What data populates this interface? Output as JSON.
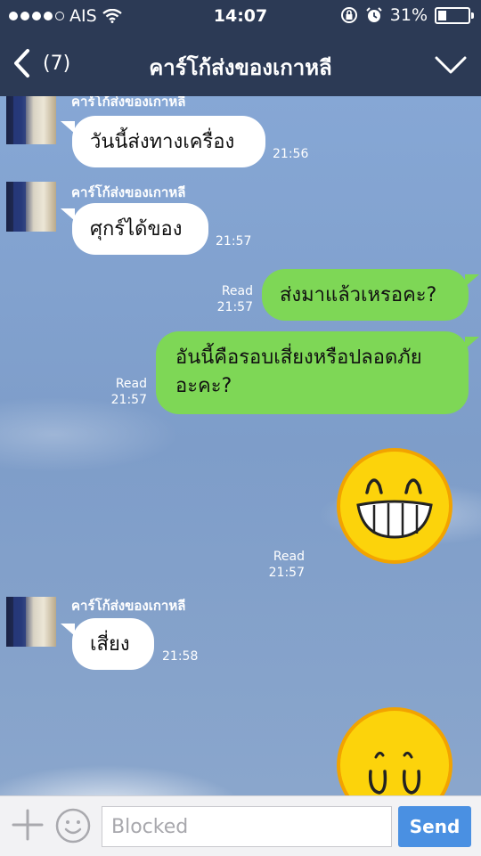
{
  "status_bar": {
    "carrier": "AIS",
    "time": "14:07",
    "battery": "31%",
    "battery_level": 0.31
  },
  "header": {
    "back_count": "(7)",
    "title": "คาร์โก้ส่งของเกาหลี"
  },
  "messages": [
    {
      "sender": "คาร์โก้ส่งของเกาหลี",
      "text": "วันนี้ส่งทางเครื่อง",
      "time": "21:56"
    },
    {
      "sender": "คาร์โก้ส่งของเกาหลี",
      "text": "ศุกร์ได้ของ",
      "time": "21:57"
    },
    {
      "read": "Read",
      "time": "21:57",
      "text": "ส่งมาแล้วเหรอคะ?"
    },
    {
      "read": "Read",
      "time": "21:57",
      "text": "อันนี้คือรอบเสี่ยงหรือปลอดภัย อะคะ?"
    },
    {
      "read": "Read",
      "time": "21:57",
      "sticker": "grinning-sweat-sticker"
    },
    {
      "sender": "คาร์โก้ส่งของเกาหลี",
      "text": "เสี่ยง",
      "time": "21:58"
    },
    {
      "sticker": "worried-sticker"
    }
  ],
  "input_bar": {
    "placeholder": "Blocked",
    "send_label": "Send"
  },
  "colors": {
    "header_bg": "#2c3a55",
    "outgoing_bubble": "#7ed756",
    "incoming_bubble": "#ffffff",
    "send_button": "#4a90e2"
  }
}
